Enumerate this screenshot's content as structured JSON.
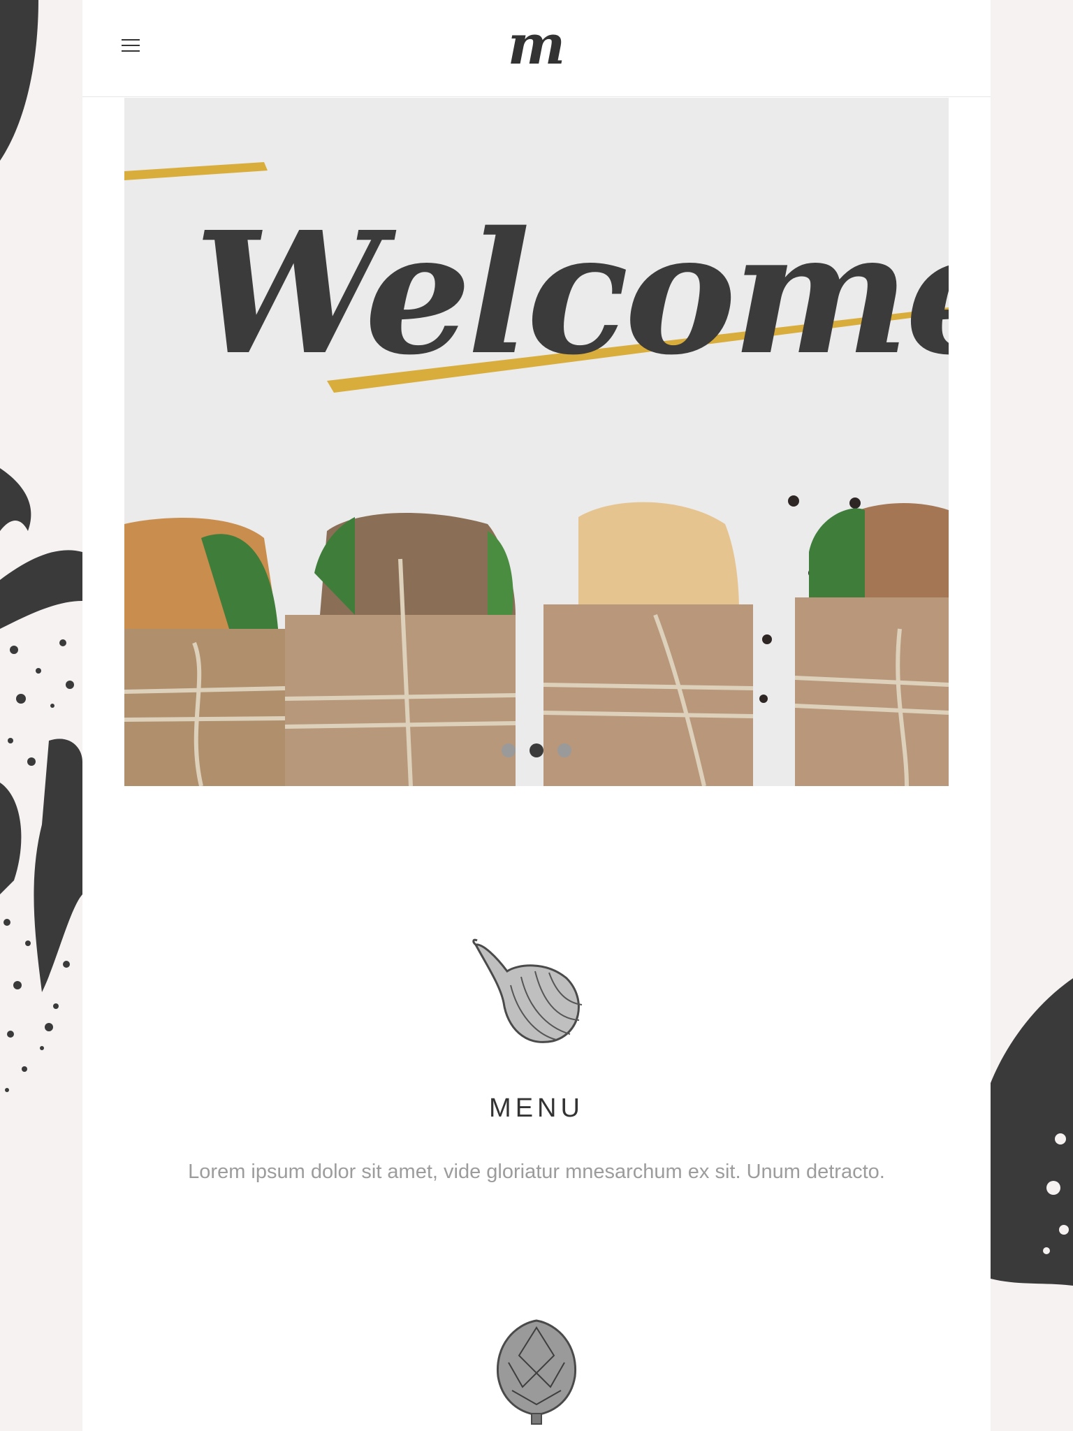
{
  "header": {
    "logo_text": "m",
    "menu_icon": "hamburger-icon"
  },
  "hero": {
    "welcome_text": "Welcome!",
    "accent_color": "#d9ad3c",
    "slides": [
      {
        "state": "inactive"
      },
      {
        "state": "active"
      },
      {
        "state": "inactive"
      }
    ]
  },
  "menu_section": {
    "icon": "onion-icon",
    "title": "MENU",
    "description": "Lorem ipsum dolor sit amet, vide gloriatur mnesarchum ex sit. Unum detracto."
  },
  "next_section": {
    "icon": "artichoke-icon"
  }
}
